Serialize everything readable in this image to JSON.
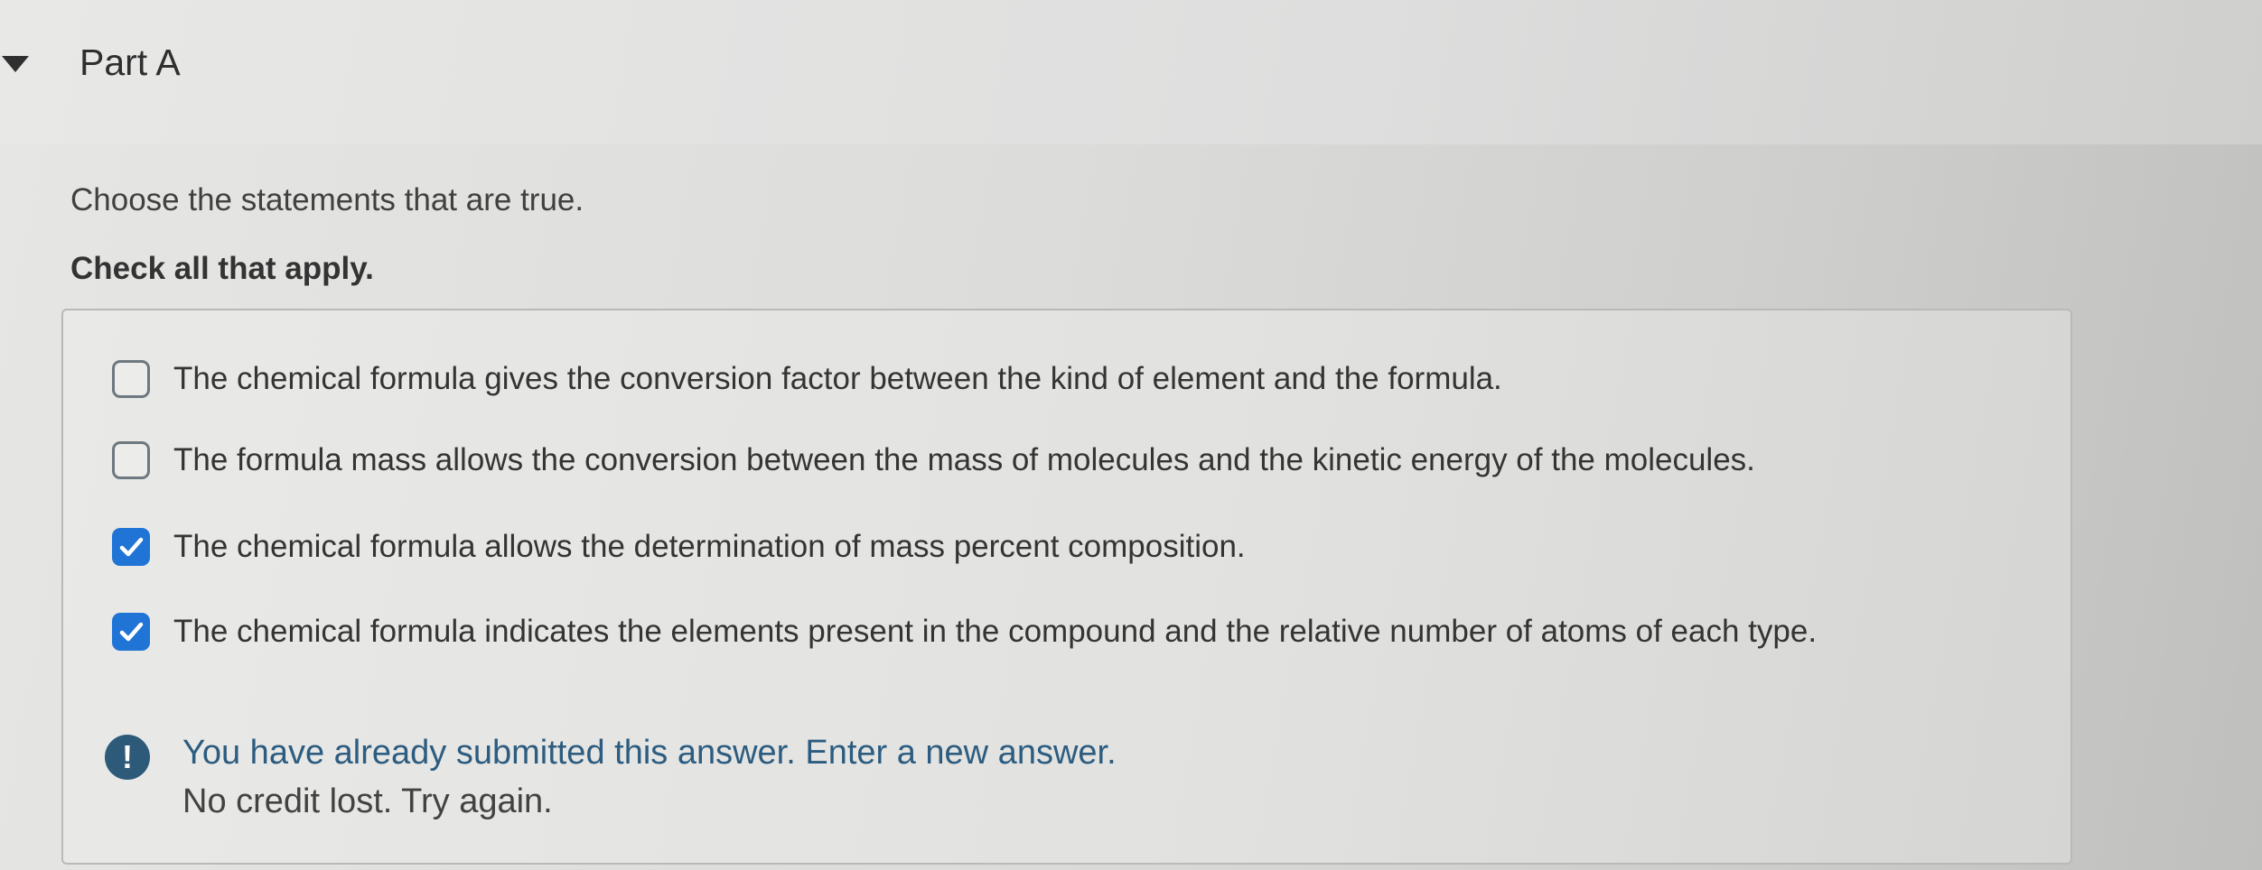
{
  "part": {
    "title": "Part A",
    "toggle_icon": "triangle-down-icon"
  },
  "question": {
    "prompt": "Choose the statements that are true.",
    "instruction": "Check all that apply."
  },
  "options": [
    {
      "label": "The chemical formula gives the conversion factor between the kind of element and the formula.",
      "checked": false
    },
    {
      "label": "The formula mass allows the conversion between the mass of molecules and the kinetic energy of the molecules.",
      "checked": false
    },
    {
      "label": "The chemical formula allows the determination of mass percent composition.",
      "checked": true
    },
    {
      "label": "The chemical formula indicates the elements present in the compound and the relative number of atoms of each type.",
      "checked": true
    }
  ],
  "feedback": {
    "icon": "exclamation-circle-icon",
    "icon_glyph": "!",
    "line1": "You have already submitted this answer. Enter a new answer.",
    "line2": "No credit lost. Try again."
  },
  "colors": {
    "checkbox_checked": "#1f74d6",
    "feedback_text": "#2c5c80",
    "feedback_icon_bg": "#2e5a7a"
  }
}
